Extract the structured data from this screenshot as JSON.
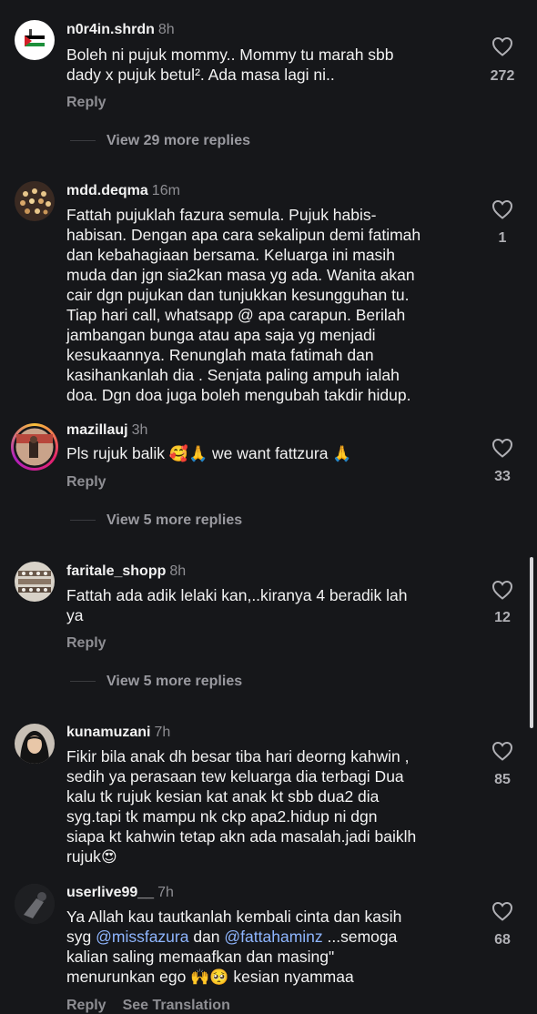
{
  "comments": [
    {
      "username": "n0r4in.shrdn",
      "time": "8h",
      "text": "Boleh ni pujuk mommy.. Mommy tu marah sbb\ndady x pujuk betul². Ada masa lagi ni..",
      "likes": "272",
      "reply_label": "Reply",
      "view_more": "View 29 more replies",
      "avatar_icon": "flag-avatar-icon"
    },
    {
      "username": "mdd.deqma",
      "time": "16m",
      "text": "Fattah pujuklah fazura semula. Pujuk habis-\nhabisan. Dengan apa cara sekalipun demi fatimah\ndan kebahagiaan bersama. Keluarga ini masih\nmuda dan jgn sia2kan masa yg ada. Wanita akan\ncair dgn pujukan dan tunjukkan kesungguhan tu.\nTiap hari call, whatsapp @ apa carapun. Berilah\njambangan bunga atau apa saja yg menjadi\nkesukaannya. Renunglah mata fatimah dan\nkasihankanlah dia . Senjata paling ampuh ialah\ndoa. Dgn doa juga boleh mengubah takdir hidup.",
      "likes": "1",
      "avatar_icon": "lights-avatar-icon"
    },
    {
      "username": "mazillauj",
      "time": "3h",
      "text_parts": [
        "Pls rujuk balik ",
        "🥰",
        "🙏",
        " we want fattzura ",
        "🙏"
      ],
      "likes": "33",
      "reply_label": "Reply",
      "view_more": "View 5 more replies",
      "avatar_icon": "story-avatar-icon"
    },
    {
      "username": "faritale_shopp",
      "time": "8h",
      "text": "Fattah ada adik lelaki kan,..kiranya 4 beradik lah\nya",
      "likes": "12",
      "reply_label": "Reply",
      "view_more": "View 5 more replies",
      "avatar_icon": "products-avatar-icon"
    },
    {
      "username": "kunamuzani",
      "time": "7h",
      "text": "Fikir bila anak dh besar tiba hari deorng kahwin ,\nsedih ya perasaan tew keluarga dia terbagi Dua\nkalu tk rujuk kesian kat anak kt sbb dua2 dia\nsyg.tapi tk mampu nk ckp apa2.hidup ni dgn\nsiapa kt kahwin tetap akn ada masalah.jadi baiklh\nrujuk",
      "text_emoji": "😍",
      "likes": "85",
      "avatar_icon": "hijab-avatar-icon"
    },
    {
      "username": "userlive99__",
      "time": "7h",
      "text_a": "Ya Allah kau tautkanlah kembali cinta dan kasih\nsyg ",
      "mention1": "@missfazura",
      "text_b": " dan ",
      "mention2": "@fattahaminz",
      "text_c": " ...semoga\nkalian saling memaafkan dan masing\"\nmenurunkan ego ",
      "emoji1": "🙌",
      "emoji2": "🥺",
      "text_d": " kesian nyammaa",
      "likes": "68",
      "reply_label": "Reply",
      "see_translation": "See Translation",
      "avatar_icon": "dark-avatar-icon"
    }
  ],
  "colors": {
    "background": "#16171a",
    "text": "#f2f2f2",
    "muted": "#8e8e93",
    "mention": "#8fb6ff"
  }
}
